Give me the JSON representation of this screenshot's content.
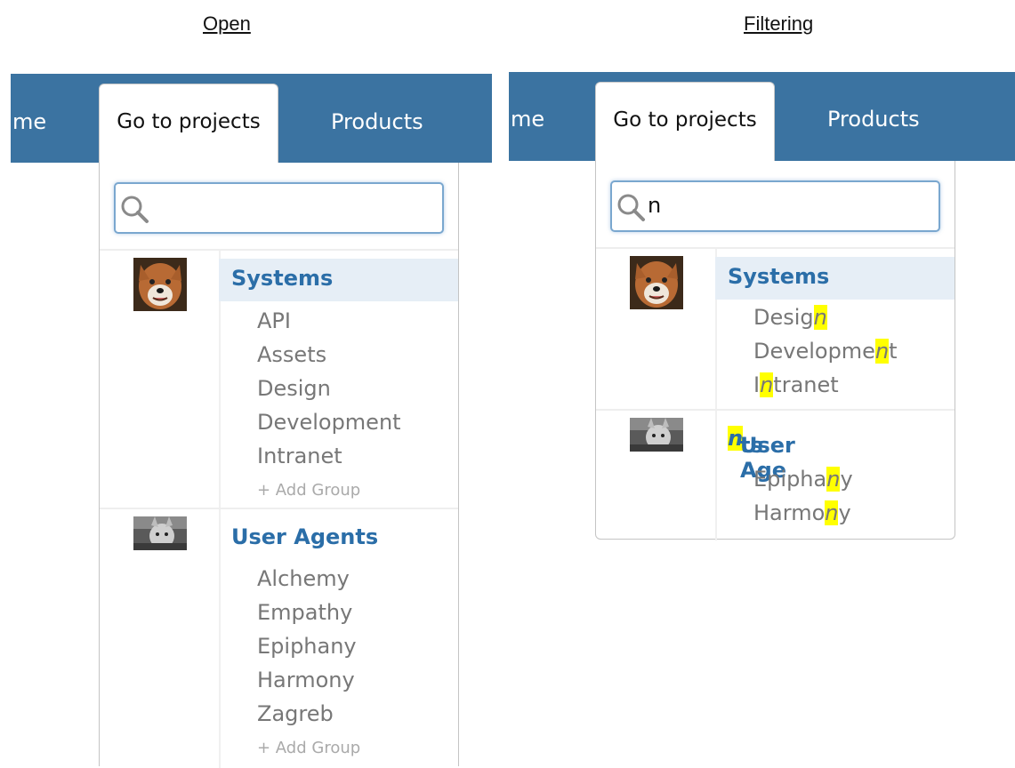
{
  "headings": {
    "left": "Open",
    "right": "Filtering"
  },
  "nav": {
    "partial": "me",
    "tab": "Go to projects",
    "products": "Products"
  },
  "left": {
    "search_value": "",
    "groups": [
      {
        "title": "Systems",
        "items": [
          "API",
          "Assets",
          "Design",
          "Development",
          "Intranet"
        ],
        "add": "+ Add Group"
      },
      {
        "title": "User Agents",
        "items": [
          "Alchemy",
          "Empathy",
          "Epiphany",
          "Harmony",
          "Zagreb"
        ],
        "add": "+ Add Group"
      }
    ]
  },
  "right": {
    "search_value": "n",
    "systems": {
      "title": "Systems",
      "design": {
        "pre": "Desig",
        "hl": "n",
        "post": ""
      },
      "development": {
        "pre": "Developme",
        "hl": "n",
        "post": "t"
      },
      "intranet": {
        "pre": "I",
        "hl": "n",
        "post": "tranet"
      }
    },
    "agents": {
      "title": {
        "pre": "User Age",
        "hl": "n",
        "post": "ts"
      },
      "epiphany": {
        "pre": "Epipha",
        "hl": "n",
        "post": "y"
      },
      "harmony": {
        "pre": "Harmo",
        "hl": "n",
        "post": "y"
      }
    }
  },
  "colors": {
    "nav_blue": "#3b73a1",
    "group_title": "#2b6ea8",
    "highlight": "#ffff00",
    "item_grey": "#777777"
  },
  "icons": {
    "search": "magnifier-icon"
  }
}
